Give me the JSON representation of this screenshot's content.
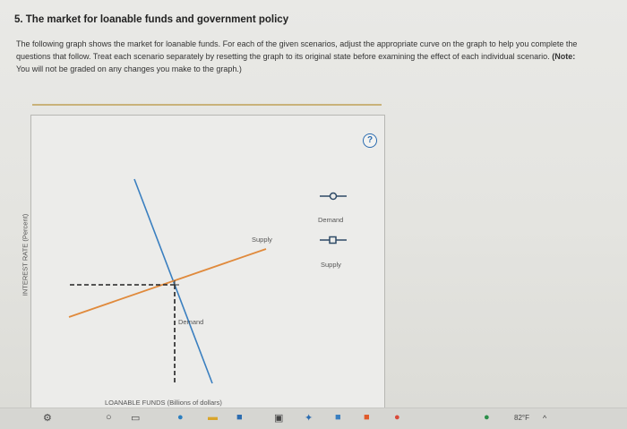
{
  "question": {
    "title": "5. The market for loanable funds and government policy",
    "instructions": "The following graph shows the market for loanable funds. For each of the given scenarios, adjust the appropriate curve on the graph to help you complete the questions that follow. Treat each scenario separately by resetting the graph to its original state before examining the effect of each individual scenario.",
    "note_label": "(Note:",
    "note_text": "You will not be graded on any changes you make to the graph.)"
  },
  "graph": {
    "help_symbol": "?",
    "y_axis_label": "INTEREST RATE (Percent)",
    "x_axis_label": "LOANABLE FUNDS (Billions of dollars)",
    "supply_curve_label": "Supply",
    "demand_curve_label": "Demand",
    "legend": [
      {
        "label": "Demand",
        "marker": "circle",
        "color": "#2e4a66"
      },
      {
        "label": "Supply",
        "marker": "square",
        "color": "#2e4a66"
      }
    ],
    "supply_color": "#e08a3c",
    "demand_color": "#3a7fc0"
  },
  "taskbar": {
    "weather": "82°F"
  }
}
